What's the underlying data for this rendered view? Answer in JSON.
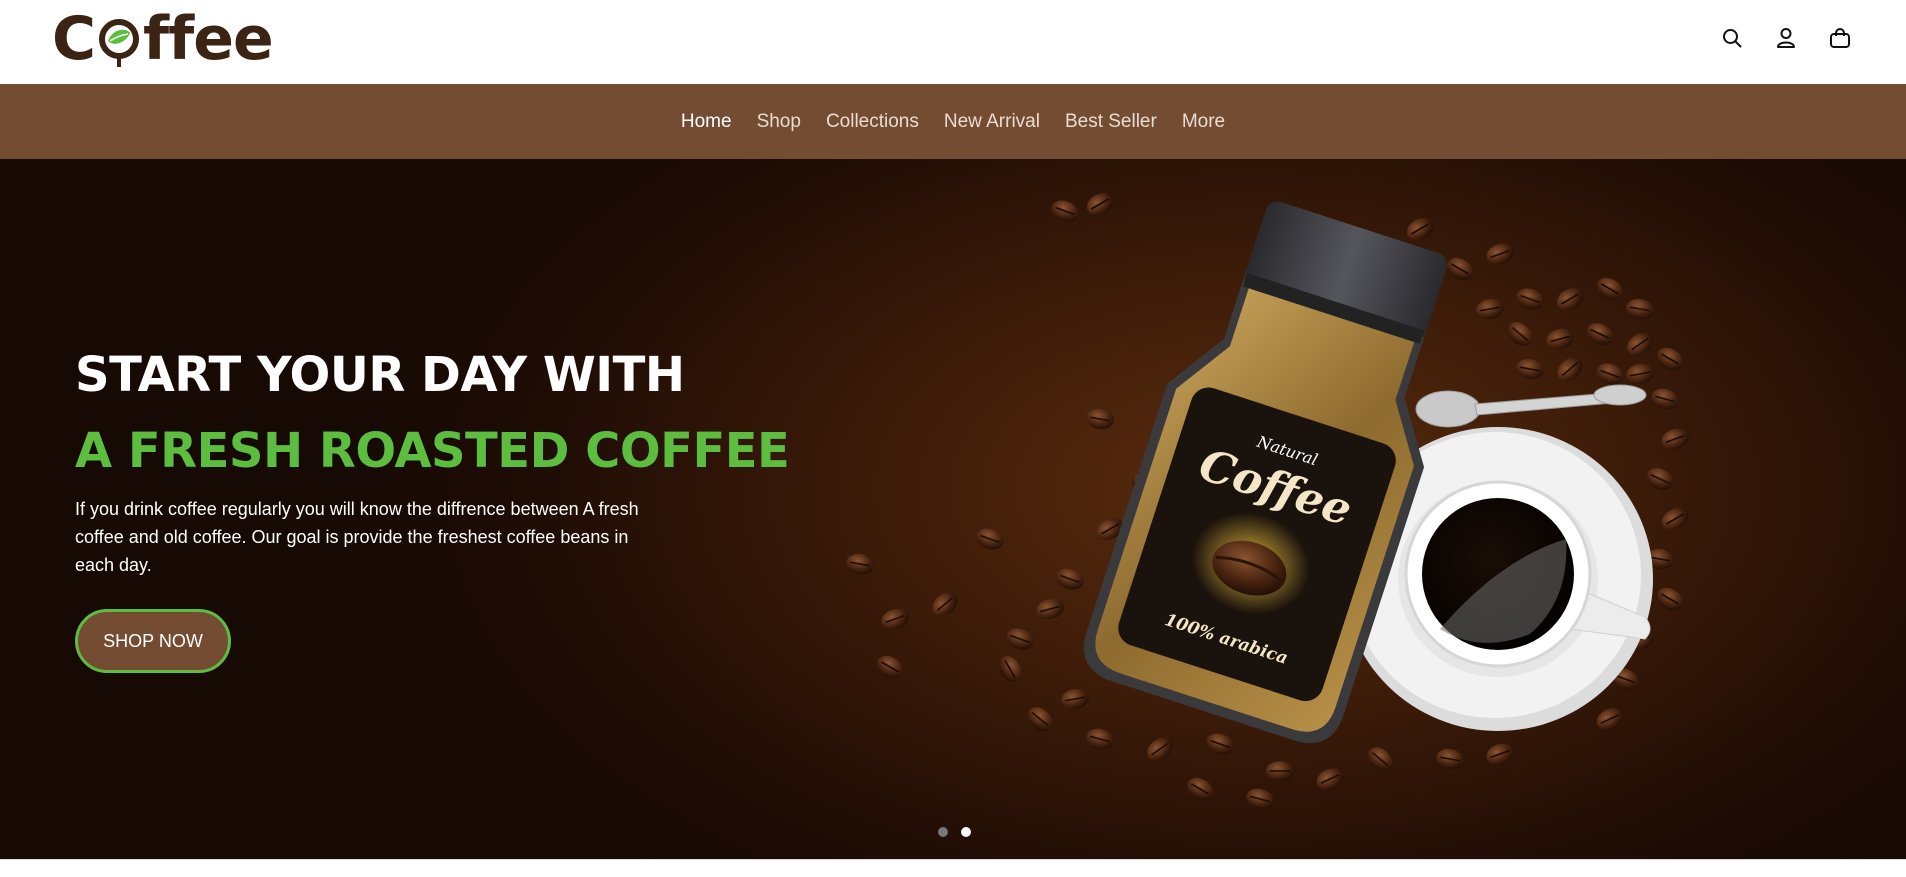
{
  "brand": {
    "logo_text_start": "C",
    "logo_text_end": "ffee"
  },
  "header_icons": [
    "search-icon",
    "user-icon",
    "bag-icon"
  ],
  "nav": {
    "items": [
      {
        "label": "Home",
        "active": true
      },
      {
        "label": "Shop",
        "active": false
      },
      {
        "label": "Collections",
        "active": false
      },
      {
        "label": "New Arrival",
        "active": false
      },
      {
        "label": "Best Seller",
        "active": false
      },
      {
        "label": "More",
        "active": false
      }
    ]
  },
  "hero": {
    "title_line1": "START YOUR DAY WITH",
    "title_line2": "A FRESH ROASTED COFFEE",
    "description": "If you drink coffee regularly you will know the diffrence between A fresh coffee and old coffee. Our goal is provide the freshest coffee beans in each day.",
    "cta_label": "SHOP NOW",
    "jar_label_top": "Natural",
    "jar_label_main": "Coffee",
    "jar_label_bottom": "100% arabica",
    "slides": {
      "count": 2,
      "active_index": 1
    }
  },
  "colors": {
    "brand_dark": "#3b2414",
    "nav_bg": "#744c31",
    "accent_green": "#5cbd3e",
    "hero_bg": "#2a1207"
  }
}
